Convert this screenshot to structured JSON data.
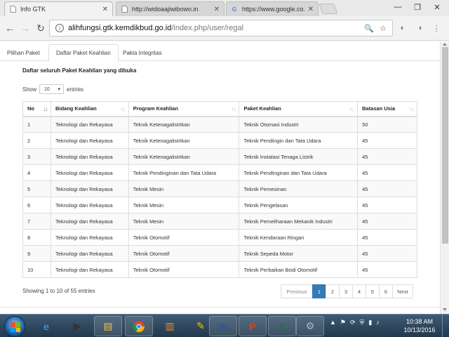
{
  "browser": {
    "tabs": [
      {
        "title": "Info GTK",
        "favicon": "page-icon",
        "active": true
      },
      {
        "title": "http://widoaajiwibowo.in",
        "favicon": "page-icon",
        "active": false
      },
      {
        "title": "https://www.google.co.id",
        "favicon": "google-icon",
        "active": false
      }
    ],
    "url_host": "alihfungsi.gtk.kemdikbud.go.id",
    "url_path": "/index.php/user/regal"
  },
  "page": {
    "nav_tabs": [
      {
        "label": "Pilihan Paket",
        "active": false
      },
      {
        "label": "Daftar Paket Keahlian",
        "active": true
      },
      {
        "label": "Pakta Integritas",
        "active": false
      }
    ],
    "section_title": "Daftar seluruh Paket Keahlian yang dibuka",
    "length_menu": {
      "prefix": "Show",
      "value": "10",
      "suffix": "entries"
    },
    "table": {
      "columns": [
        "No",
        "Bidang Keahlian",
        "Program Keahlian",
        "Paket Keahlian",
        "Batasan Usia"
      ],
      "rows": [
        [
          "1",
          "Teknologi dan Rekayasa",
          "Teknik Ketenagalistrikan",
          "Teknik Otomasi Industri",
          "50"
        ],
        [
          "2",
          "Teknologi dan Rekayasa",
          "Teknik Ketenagalistrikan",
          "Teknik Pendingin dan Tata Udara",
          "45"
        ],
        [
          "3",
          "Teknologi dan Rekayasa",
          "Teknik Ketenagalistrikan",
          "Teknik Instalasi Tenaga Listrik",
          "45"
        ],
        [
          "4",
          "Teknologi dan Rekayasa",
          "Teknik Pendinginan dan Tata Udara",
          "Teknik Pendinginan dan Tata Udara",
          "45"
        ],
        [
          "5",
          "Teknologi dan Rekayasa",
          "Teknik Mesin",
          "Teknik Pemesinan",
          "45"
        ],
        [
          "6",
          "Teknologi dan Rekayasa",
          "Teknik Mesin",
          "Teknik Pengelasan",
          "45"
        ],
        [
          "7",
          "Teknologi dan Rekayasa",
          "Teknik Mesin",
          "Teknik Pemeliharaan Mekanik Industri",
          "45"
        ],
        [
          "8",
          "Teknologi dan Rekayasa",
          "Teknik Otomotif",
          "Teknik Kendaraan Ringan",
          "45"
        ],
        [
          "9",
          "Teknologi dan Rekayasa",
          "Teknik Otomotif",
          "Teknik Sepeda Motor",
          "45"
        ],
        [
          "10",
          "Teknologi dan Rekayasa",
          "Teknik Otomotif",
          "Teknik Perbaikan Bodi Otomotif",
          "45"
        ]
      ]
    },
    "info": "Showing 1 to 10 of 55 entries",
    "pagination": {
      "previous": "Previous",
      "pages": [
        "1",
        "2",
        "3",
        "4",
        "5",
        "6"
      ],
      "current": "1",
      "next": "Next"
    }
  },
  "taskbar": {
    "time": "10:38 AM",
    "date": "10/13/2016"
  }
}
